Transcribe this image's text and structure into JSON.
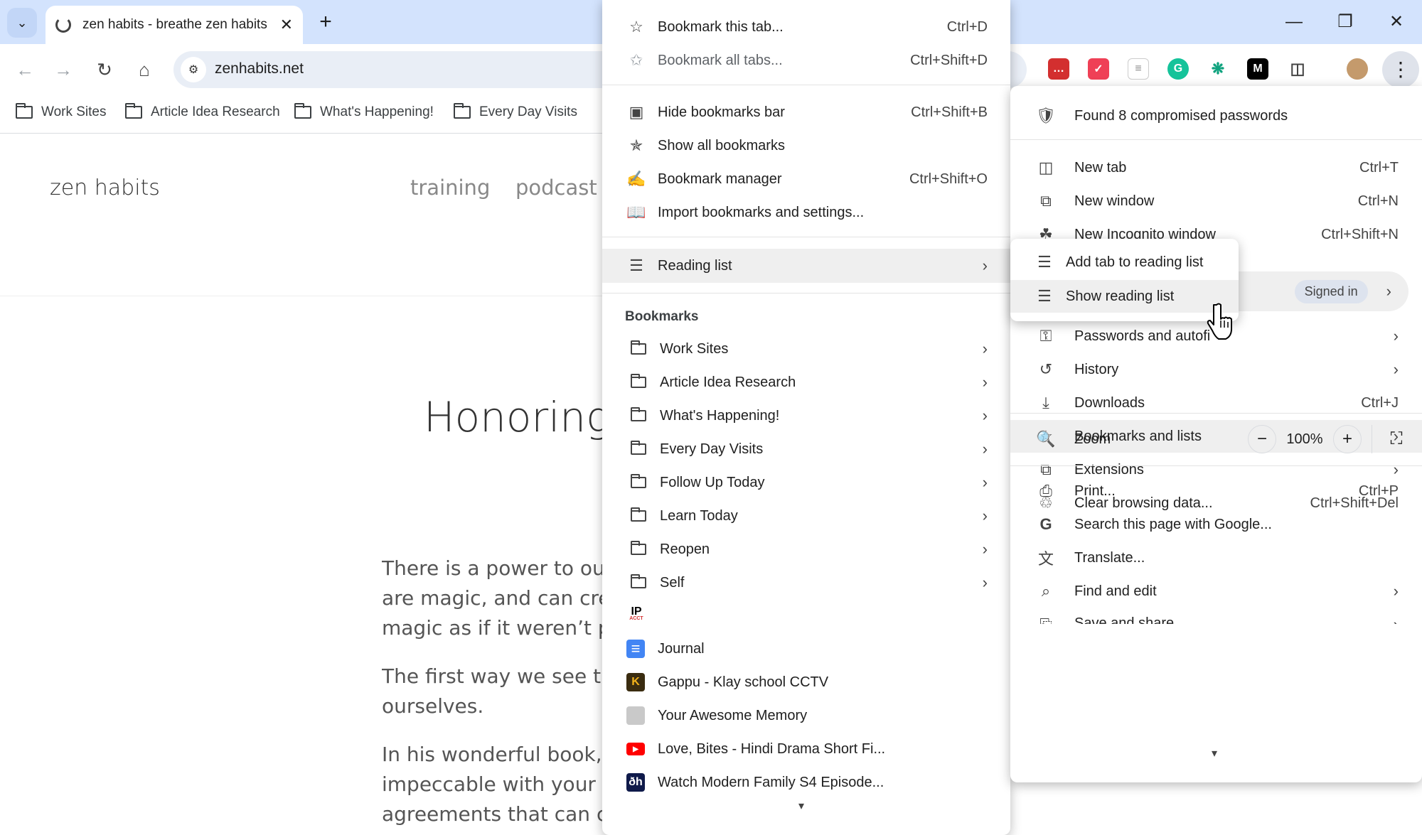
{
  "tab": {
    "title": "zen habits - breathe zen habits"
  },
  "omnibox": {
    "url": "zenhabits.net"
  },
  "bookmarks_bar": [
    {
      "label": "Work Sites"
    },
    {
      "label": "Article Idea Research"
    },
    {
      "label": "What's Happening!"
    },
    {
      "label": "Every Day Visits"
    }
  ],
  "page": {
    "site_name": "zen habits",
    "nav": [
      "training",
      "podcast"
    ],
    "title": "Honoring Y",
    "paragraphs": [
      [
        "There is a power to our w",
        "are magic, and can create",
        "magic as if it weren’t pow"
      ],
      [
        "The first way we see this",
        "ourselves."
      ],
      [
        "In his wonderful book, Th",
        "impeccable with your wo",
        "agreements that can chan"
      ]
    ]
  },
  "bookmarks_menu": {
    "items_top": [
      {
        "label": "Bookmark this tab...",
        "shortcut": "Ctrl+D",
        "icon": "star-icon"
      },
      {
        "label": "Bookmark all tabs...",
        "shortcut": "Ctrl+Shift+D",
        "icon": "star-all-icon"
      }
    ],
    "items_mid": [
      {
        "label": "Hide bookmarks bar",
        "shortcut": "Ctrl+Shift+B",
        "icon": "bookmarks-bar-icon"
      },
      {
        "label": "Show all bookmarks",
        "shortcut": "",
        "icon": "all-bookmarks-icon"
      },
      {
        "label": "Bookmark manager",
        "shortcut": "Ctrl+Shift+O",
        "icon": "bookmark-manager-icon"
      },
      {
        "label": "Import bookmarks and settings...",
        "shortcut": "",
        "icon": "import-icon"
      }
    ],
    "reading_list": {
      "label": "Reading list"
    },
    "section_header": "Bookmarks",
    "folders": [
      "Work Sites",
      "Article Idea Research",
      "What's Happening!",
      "Every Day Visits",
      "Follow Up Today",
      "Learn Today",
      "Reopen",
      "Self"
    ],
    "ip_favicon": "IP",
    "ip_favicon_sub": "ACCT",
    "links": [
      {
        "label": "Journal",
        "icon": "google-docs-icon",
        "color": "#4285f4"
      },
      {
        "label": "Gappu - Klay school CCTV",
        "icon": "k-favicon",
        "glyph": "K",
        "color": "#3a2c10"
      },
      {
        "label": "Your Awesome Memory",
        "icon": "memory-favicon",
        "color": "#c9c9c9"
      },
      {
        "label": "Love, Bites - Hindi Drama Short Fi...",
        "icon": "youtube-icon",
        "color": "#ff0000"
      },
      {
        "label": "Watch Modern Family S4 Episode...",
        "icon": "hotstar-icon",
        "glyph": "ðh",
        "color": "#0f1a4a"
      }
    ]
  },
  "reading_list_submenu": {
    "items": [
      {
        "label": "Add tab to reading list",
        "icon": "add-to-list-icon"
      },
      {
        "label": "Show reading list",
        "icon": "reading-list-icon"
      }
    ]
  },
  "chrome_menu": {
    "alert": "Found 8 compromised passwords",
    "items": [
      {
        "label": "New tab",
        "shortcut": "Ctrl+T",
        "icon": "new-tab-icon"
      },
      {
        "label": "New window",
        "shortcut": "Ctrl+N",
        "icon": "new-window-icon"
      },
      {
        "label": "New Incognito window",
        "shortcut": "Ctrl+Shift+N",
        "icon": "incognito-icon"
      }
    ],
    "signed_in": "Signed in",
    "items2": [
      {
        "label": "Passwords and autofi",
        "shortcut": "",
        "icon": "key-icon",
        "arrow": true
      },
      {
        "label": "History",
        "shortcut": "",
        "icon": "history-icon",
        "arrow": true
      },
      {
        "label": "Downloads",
        "shortcut": "Ctrl+J",
        "icon": "download-icon",
        "arrow": false
      },
      {
        "label": "Bookmarks and lists",
        "shortcut": "",
        "icon": "star-icon",
        "arrow": true
      },
      {
        "label": "Extensions",
        "shortcut": "",
        "icon": "puzzle-icon",
        "arrow": true
      },
      {
        "label": "Clear browsing data...",
        "shortcut": "Ctrl+Shift+Del",
        "icon": "trash-icon",
        "arrow": false
      }
    ],
    "zoom": {
      "label": "Zoom",
      "value": "100%",
      "minus": "−",
      "plus": "+"
    },
    "items3": [
      {
        "label": "Print...",
        "shortcut": "Ctrl+P",
        "icon": "print-icon",
        "arrow": false
      },
      {
        "label": "Search this page with Google...",
        "shortcut": "",
        "icon": "google-icon",
        "arrow": false
      },
      {
        "label": "Translate...",
        "shortcut": "",
        "icon": "translate-icon",
        "arrow": false
      },
      {
        "label": "Find and edit",
        "shortcut": "",
        "icon": "find-icon",
        "arrow": true
      },
      {
        "label": "Save and share",
        "shortcut": "",
        "icon": "save-icon",
        "arrow": true
      }
    ]
  }
}
